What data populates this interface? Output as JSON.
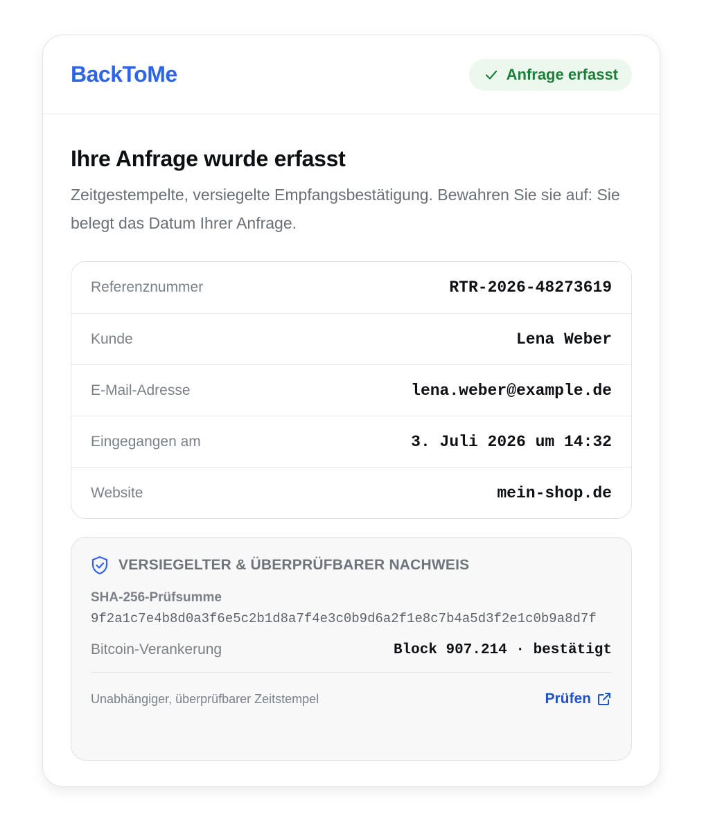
{
  "header": {
    "brand": "BackToMe",
    "status_badge": "Anfrage erfasst",
    "status_icon": "check-icon",
    "status_color": "#1c7f3a"
  },
  "main": {
    "title": "Ihre Anfrage wurde erfasst",
    "subtitle": "Zeitgestempelte, versiegelte Empfangsbestätigung. Bewahren Sie sie auf: Sie belegt das Datum Ihrer Anfrage."
  },
  "details": [
    {
      "label": "Referenznummer",
      "value": "RTR-2026-48273619"
    },
    {
      "label": "Kunde",
      "value": "Lena Weber"
    },
    {
      "label": "E-Mail-Adresse",
      "value": "lena.weber@example.de"
    },
    {
      "label": "Eingegangen am",
      "value": "3. Juli 2026 um 14:32"
    },
    {
      "label": "Website",
      "value": "mein-shop.de"
    }
  ],
  "proof": {
    "icon": "shield-check-icon",
    "heading": "VERSIEGELTER & ÜBERPRÜFBARER NACHWEIS",
    "hash_label": "SHA-256-Prüfsumme",
    "hash_value": "9f2a1c7e4b8d0a3f6e5c2b1d8a7f4e3c0b9d6a2f1e8c7b4a5d3f2e1c0b9a8d7f",
    "anchor_label": "Bitcoin-Verankerung",
    "anchor_value": "Block 907.214 · bestätigt",
    "footer_note": "Unabhängiger, überprüfbarer Zeitstempel",
    "verify_label": "Prüfen",
    "verify_icon": "external-link-icon"
  },
  "colors": {
    "brand": "#2f63e8",
    "success": "#1c7f3a",
    "success_bg": "#ecf8ee",
    "link": "#2152c8"
  }
}
